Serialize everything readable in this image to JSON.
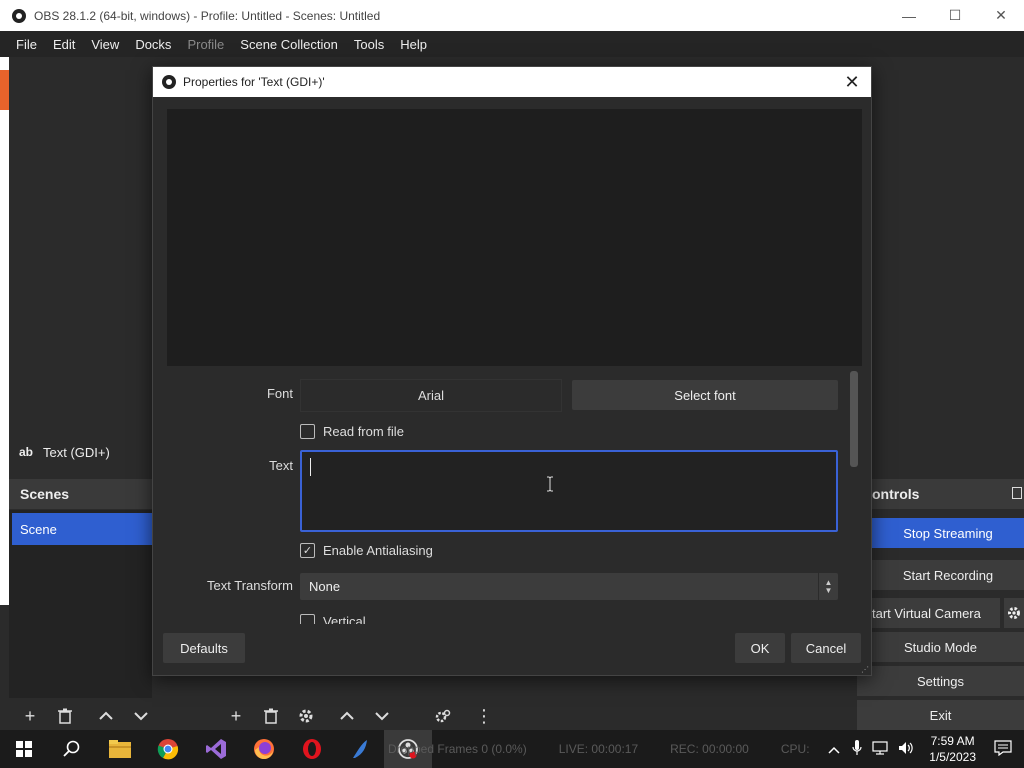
{
  "window": {
    "title": "OBS 28.1.2 (64-bit, windows) - Profile: Untitled - Scenes: Untitled",
    "min": "—",
    "max": "☐",
    "close": "✕"
  },
  "menu": {
    "items": [
      "File",
      "Edit",
      "View",
      "Docks",
      "Profile",
      "Scene Collection",
      "Tools",
      "Help"
    ]
  },
  "sources": {
    "item_icon": "ab",
    "item_label": "Text (GDI+)"
  },
  "scenes": {
    "header": "Scenes",
    "selected": "Scene"
  },
  "controls": {
    "header": "ontrols",
    "buttons": [
      "Stop Streaming",
      "Start Recording",
      "tart Virtual Camera",
      "Studio Mode",
      "Settings",
      "Exit"
    ]
  },
  "status": {
    "dropped": "Dropped Frames 0 (0.0%)",
    "live": "LIVE: 00:00:17",
    "rec": "REC: 00:00:00",
    "cpu": "CPU: "
  },
  "tray": {
    "time": "7:59 AM",
    "date": "1/5/2023"
  },
  "dialog": {
    "title": "Properties for 'Text (GDI+)'",
    "font_label": "Font",
    "font_value": "Arial",
    "select_font": "Select font",
    "read_from_file": "Read from file",
    "text_label": "Text",
    "text_value": "",
    "antialiasing": "Enable Antialiasing",
    "text_transform_label": "Text Transform",
    "text_transform_value": "None",
    "vertical": "Vertical",
    "defaults": "Defaults",
    "ok": "OK",
    "cancel": "Cancel"
  },
  "colors": {
    "accent": "#2f5fd0",
    "dark_bg": "#2b2b2b",
    "focus_border": "#3a62d6"
  }
}
